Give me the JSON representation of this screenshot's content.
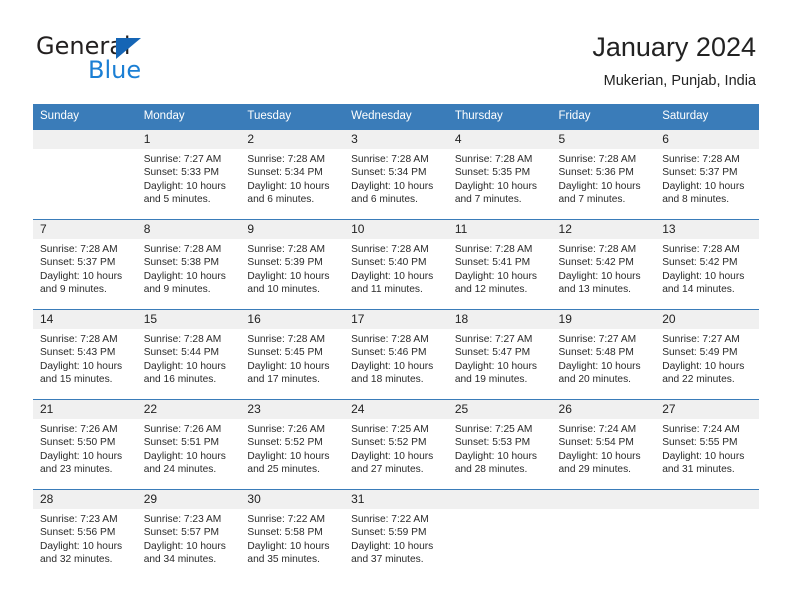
{
  "brand": {
    "name_part1": "General",
    "name_part2": "Blue",
    "accent_color": "#1b7fd4",
    "triangle_color": "#1565b5"
  },
  "header": {
    "title": "January 2024",
    "subtitle": "Mukerian, Punjab, India"
  },
  "calendar": {
    "header_bg": "#3a7cb9",
    "daynum_bg": "#f0f0f0",
    "weekday_headers": [
      "Sunday",
      "Monday",
      "Tuesday",
      "Wednesday",
      "Thursday",
      "Friday",
      "Saturday"
    ],
    "weeks": [
      [
        {
          "day": "",
          "empty": true,
          "sunrise": "",
          "sunset": "",
          "daylight_line1": "",
          "daylight_line2": ""
        },
        {
          "day": "1",
          "sunrise": "Sunrise: 7:27 AM",
          "sunset": "Sunset: 5:33 PM",
          "daylight_line1": "Daylight: 10 hours",
          "daylight_line2": "and 5 minutes."
        },
        {
          "day": "2",
          "sunrise": "Sunrise: 7:28 AM",
          "sunset": "Sunset: 5:34 PM",
          "daylight_line1": "Daylight: 10 hours",
          "daylight_line2": "and 6 minutes."
        },
        {
          "day": "3",
          "sunrise": "Sunrise: 7:28 AM",
          "sunset": "Sunset: 5:34 PM",
          "daylight_line1": "Daylight: 10 hours",
          "daylight_line2": "and 6 minutes."
        },
        {
          "day": "4",
          "sunrise": "Sunrise: 7:28 AM",
          "sunset": "Sunset: 5:35 PM",
          "daylight_line1": "Daylight: 10 hours",
          "daylight_line2": "and 7 minutes."
        },
        {
          "day": "5",
          "sunrise": "Sunrise: 7:28 AM",
          "sunset": "Sunset: 5:36 PM",
          "daylight_line1": "Daylight: 10 hours",
          "daylight_line2": "and 7 minutes."
        },
        {
          "day": "6",
          "sunrise": "Sunrise: 7:28 AM",
          "sunset": "Sunset: 5:37 PM",
          "daylight_line1": "Daylight: 10 hours",
          "daylight_line2": "and 8 minutes."
        }
      ],
      [
        {
          "day": "7",
          "sunrise": "Sunrise: 7:28 AM",
          "sunset": "Sunset: 5:37 PM",
          "daylight_line1": "Daylight: 10 hours",
          "daylight_line2": "and 9 minutes."
        },
        {
          "day": "8",
          "sunrise": "Sunrise: 7:28 AM",
          "sunset": "Sunset: 5:38 PM",
          "daylight_line1": "Daylight: 10 hours",
          "daylight_line2": "and 9 minutes."
        },
        {
          "day": "9",
          "sunrise": "Sunrise: 7:28 AM",
          "sunset": "Sunset: 5:39 PM",
          "daylight_line1": "Daylight: 10 hours",
          "daylight_line2": "and 10 minutes."
        },
        {
          "day": "10",
          "sunrise": "Sunrise: 7:28 AM",
          "sunset": "Sunset: 5:40 PM",
          "daylight_line1": "Daylight: 10 hours",
          "daylight_line2": "and 11 minutes."
        },
        {
          "day": "11",
          "sunrise": "Sunrise: 7:28 AM",
          "sunset": "Sunset: 5:41 PM",
          "daylight_line1": "Daylight: 10 hours",
          "daylight_line2": "and 12 minutes."
        },
        {
          "day": "12",
          "sunrise": "Sunrise: 7:28 AM",
          "sunset": "Sunset: 5:42 PM",
          "daylight_line1": "Daylight: 10 hours",
          "daylight_line2": "and 13 minutes."
        },
        {
          "day": "13",
          "sunrise": "Sunrise: 7:28 AM",
          "sunset": "Sunset: 5:42 PM",
          "daylight_line1": "Daylight: 10 hours",
          "daylight_line2": "and 14 minutes."
        }
      ],
      [
        {
          "day": "14",
          "sunrise": "Sunrise: 7:28 AM",
          "sunset": "Sunset: 5:43 PM",
          "daylight_line1": "Daylight: 10 hours",
          "daylight_line2": "and 15 minutes."
        },
        {
          "day": "15",
          "sunrise": "Sunrise: 7:28 AM",
          "sunset": "Sunset: 5:44 PM",
          "daylight_line1": "Daylight: 10 hours",
          "daylight_line2": "and 16 minutes."
        },
        {
          "day": "16",
          "sunrise": "Sunrise: 7:28 AM",
          "sunset": "Sunset: 5:45 PM",
          "daylight_line1": "Daylight: 10 hours",
          "daylight_line2": "and 17 minutes."
        },
        {
          "day": "17",
          "sunrise": "Sunrise: 7:28 AM",
          "sunset": "Sunset: 5:46 PM",
          "daylight_line1": "Daylight: 10 hours",
          "daylight_line2": "and 18 minutes."
        },
        {
          "day": "18",
          "sunrise": "Sunrise: 7:27 AM",
          "sunset": "Sunset: 5:47 PM",
          "daylight_line1": "Daylight: 10 hours",
          "daylight_line2": "and 19 minutes."
        },
        {
          "day": "19",
          "sunrise": "Sunrise: 7:27 AM",
          "sunset": "Sunset: 5:48 PM",
          "daylight_line1": "Daylight: 10 hours",
          "daylight_line2": "and 20 minutes."
        },
        {
          "day": "20",
          "sunrise": "Sunrise: 7:27 AM",
          "sunset": "Sunset: 5:49 PM",
          "daylight_line1": "Daylight: 10 hours",
          "daylight_line2": "and 22 minutes."
        }
      ],
      [
        {
          "day": "21",
          "sunrise": "Sunrise: 7:26 AM",
          "sunset": "Sunset: 5:50 PM",
          "daylight_line1": "Daylight: 10 hours",
          "daylight_line2": "and 23 minutes."
        },
        {
          "day": "22",
          "sunrise": "Sunrise: 7:26 AM",
          "sunset": "Sunset: 5:51 PM",
          "daylight_line1": "Daylight: 10 hours",
          "daylight_line2": "and 24 minutes."
        },
        {
          "day": "23",
          "sunrise": "Sunrise: 7:26 AM",
          "sunset": "Sunset: 5:52 PM",
          "daylight_line1": "Daylight: 10 hours",
          "daylight_line2": "and 25 minutes."
        },
        {
          "day": "24",
          "sunrise": "Sunrise: 7:25 AM",
          "sunset": "Sunset: 5:52 PM",
          "daylight_line1": "Daylight: 10 hours",
          "daylight_line2": "and 27 minutes."
        },
        {
          "day": "25",
          "sunrise": "Sunrise: 7:25 AM",
          "sunset": "Sunset: 5:53 PM",
          "daylight_line1": "Daylight: 10 hours",
          "daylight_line2": "and 28 minutes."
        },
        {
          "day": "26",
          "sunrise": "Sunrise: 7:24 AM",
          "sunset": "Sunset: 5:54 PM",
          "daylight_line1": "Daylight: 10 hours",
          "daylight_line2": "and 29 minutes."
        },
        {
          "day": "27",
          "sunrise": "Sunrise: 7:24 AM",
          "sunset": "Sunset: 5:55 PM",
          "daylight_line1": "Daylight: 10 hours",
          "daylight_line2": "and 31 minutes."
        }
      ],
      [
        {
          "day": "28",
          "sunrise": "Sunrise: 7:23 AM",
          "sunset": "Sunset: 5:56 PM",
          "daylight_line1": "Daylight: 10 hours",
          "daylight_line2": "and 32 minutes."
        },
        {
          "day": "29",
          "sunrise": "Sunrise: 7:23 AM",
          "sunset": "Sunset: 5:57 PM",
          "daylight_line1": "Daylight: 10 hours",
          "daylight_line2": "and 34 minutes."
        },
        {
          "day": "30",
          "sunrise": "Sunrise: 7:22 AM",
          "sunset": "Sunset: 5:58 PM",
          "daylight_line1": "Daylight: 10 hours",
          "daylight_line2": "and 35 minutes."
        },
        {
          "day": "31",
          "sunrise": "Sunrise: 7:22 AM",
          "sunset": "Sunset: 5:59 PM",
          "daylight_line1": "Daylight: 10 hours",
          "daylight_line2": "and 37 minutes."
        },
        {
          "day": "",
          "empty": true,
          "sunrise": "",
          "sunset": "",
          "daylight_line1": "",
          "daylight_line2": ""
        },
        {
          "day": "",
          "empty": true,
          "sunrise": "",
          "sunset": "",
          "daylight_line1": "",
          "daylight_line2": ""
        },
        {
          "day": "",
          "empty": true,
          "sunrise": "",
          "sunset": "",
          "daylight_line1": "",
          "daylight_line2": ""
        }
      ]
    ]
  }
}
